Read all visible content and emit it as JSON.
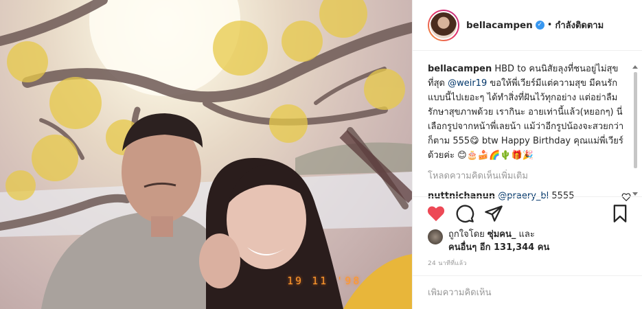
{
  "post": {
    "photo": {
      "alt": "",
      "date_stamp": "19 11 '98"
    },
    "header": {
      "username": "bellacampen",
      "separator": "•",
      "follow_state": "กำลังติดตาม"
    },
    "caption": {
      "username": "bellacampen",
      "text_1": "HBD to คนนิสัยลุงที่ชนอยู่ไม่สุขที่สุด ",
      "mention": "@weir19",
      "text_2": " ขอให้พี่เวียร์มีแต่ความสุข มีคนรักแบบนี้ไปเยอะๆ ได้ทำสิ่งที่ฝันไว้ทุกอย่าง แต่อย่าลืมรักษาสุขภาพด้วย เรากินะ อายเท่านี้แล้ว(หยอกๆ) นี่เลือกรูปจากหน้าพี่เลยน้า แม้ว่าอีกรูปน้องจะสวยกว่าก็ตาม 555😋 btw Happy Birthday คุณแม่พี่เวียร์ด้วยค่ะ 😊🎂🍰🌈🌵🎁🎉"
    },
    "load_more": "โหลดความคิดเห็นเพิ่มเติม",
    "reply": {
      "username": "nuttnichanun",
      "mention": "@praery_bl",
      "text": " 5555"
    },
    "likes": {
      "prefix": "ถูกใจโดย",
      "liker": "ซุ่มคน_",
      "and": "และ",
      "others": "คนอื่นๆ อีก 131,344 คน"
    },
    "time_ago": "24 นาทีที่แล้ว",
    "comment_input": {
      "placeholder": "เพิ่มความคิดเห็น"
    }
  },
  "colors": {
    "like_red": "#ed4956",
    "mention_blue": "#003569",
    "verified_blue": "#3897f0",
    "muted_gray": "#999999",
    "date_stamp_orange": "#ff9a2e"
  }
}
